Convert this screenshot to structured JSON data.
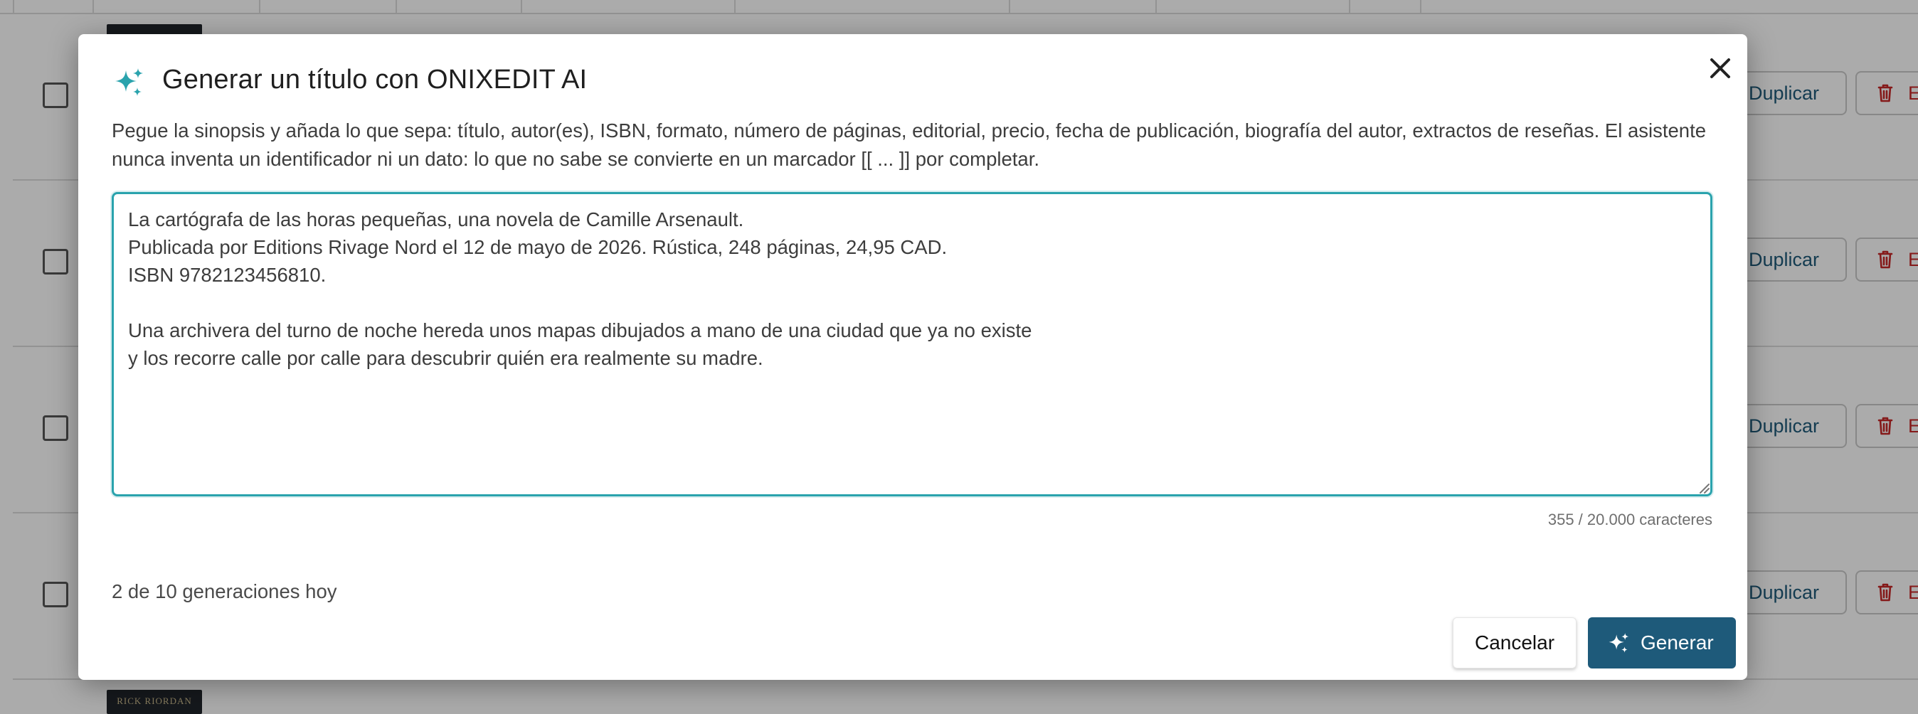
{
  "background": {
    "row_count": 4,
    "rows": [
      {
        "duplicate_label": "Duplicar",
        "delete_label": "Eli"
      },
      {
        "duplicate_label": "Duplicar",
        "delete_label": "Eli"
      },
      {
        "duplicate_label": "Duplicar",
        "delete_label": "Eli"
      },
      {
        "duplicate_label": "Duplicar",
        "delete_label": "Eli"
      }
    ],
    "bottom_cover_text": "RICK RIORDAN"
  },
  "modal": {
    "title_icon": "sparkles-icon",
    "title": "Generar un título con ONIXEDIT AI",
    "close_icon": "close-icon",
    "description": "Pegue la sinopsis y añada lo que sepa: título, autor(es), ISBN, formato, número de páginas, editorial, precio, fecha de publicación, biografía del autor, extractos de reseñas. El asistente nunca inventa un identificador ni un dato: lo que no sabe se convierte en un marcador [[ ... ]] por completar.",
    "synopsis_value": "La cartógrafa de las horas pequeñas, una novela de Camille Arsenault.\nPublicada por Editions Rivage Nord el 12 de mayo de 2026. Rústica, 248 páginas, 24,95 CAD.\nISBN 9782123456810.\n\nUna archivera del turno de noche hereda unos mapas dibujados a mano de una ciudad que ya no existe\ny los recorre calle por calle para descubrir quién era realmente su madre.",
    "char_counter": "355 / 20.000 caracteres",
    "generations_today": "2 de 10 generaciones hoy",
    "cancel_label": "Cancelar",
    "generate_label": "Generar",
    "generate_icon": "sparkles-icon"
  },
  "colors": {
    "accent": "#2aa3ad",
    "primary_button": "#1e5a7a",
    "danger": "#c62828",
    "link": "#1f5a7a"
  }
}
